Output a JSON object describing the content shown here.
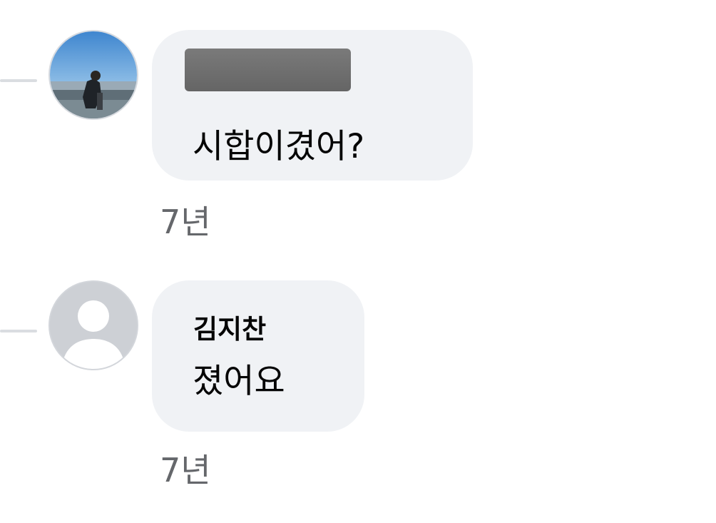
{
  "comments": [
    {
      "author": "",
      "author_redacted": true,
      "avatar": "photo-avatar",
      "text": "시합이겼어?",
      "time": "7년"
    },
    {
      "author": "김지찬",
      "author_redacted": false,
      "avatar": "default-user-avatar",
      "text": "졌어요",
      "time": "7년"
    }
  ],
  "colors": {
    "bubble": "#f0f2f5",
    "text": "#050505",
    "secondary_text": "#65676b",
    "thread_line": "#dadde1"
  }
}
